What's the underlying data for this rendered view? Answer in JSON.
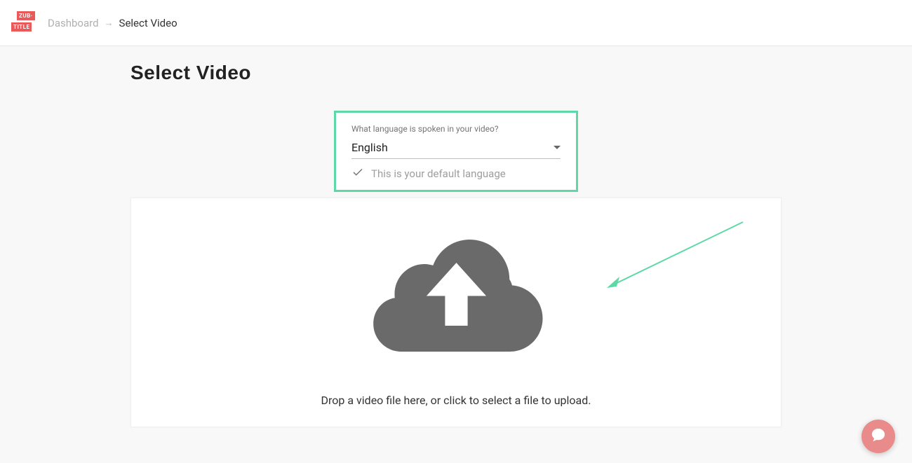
{
  "logo": {
    "top": "ZUB·",
    "bottom": "TITLE"
  },
  "breadcrumb": {
    "dashboard": "Dashboard",
    "current": "Select Video"
  },
  "page_title": "Select Video",
  "language": {
    "label": "What language is spoken in your video?",
    "selected": "English",
    "hint": "This is your default language"
  },
  "upload": {
    "prompt": "Drop a video file here, or click to select a file to upload."
  },
  "colors": {
    "accent": "#5cd9a6",
    "brand": "#e95b5b"
  }
}
